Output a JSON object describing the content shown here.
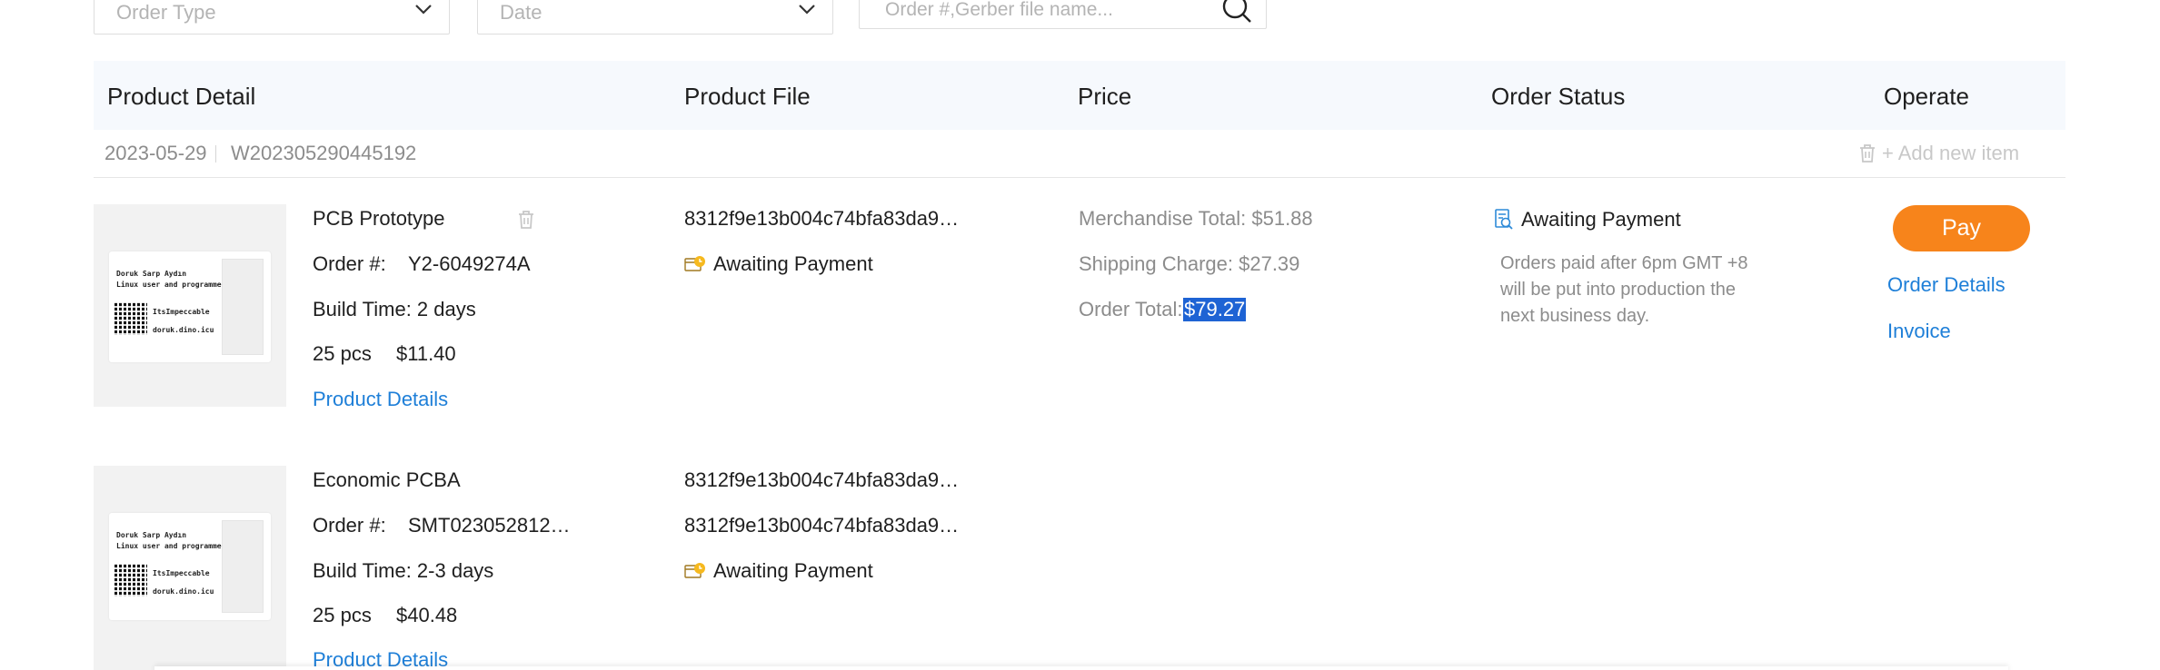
{
  "filters": {
    "order_type_placeholder": "Order Type",
    "date_placeholder": "Date",
    "search_placeholder": "Order #,Gerber file name..."
  },
  "table_headers": {
    "product_detail": "Product Detail",
    "product_file": "Product File",
    "price": "Price",
    "order_status": "Order Status",
    "operate": "Operate"
  },
  "group": {
    "date": "2023-05-29",
    "order_number": "W202305290445192",
    "add_item_label": "+ Add new item"
  },
  "rows": [
    {
      "name": "PCB Prototype",
      "order_label": "Order #:",
      "order_number": "Y2-6049274A",
      "build_time": "Build Time: 2 days",
      "qty": "25 pcs",
      "unit_price": "$11.40",
      "details_link": "Product Details",
      "file": "8312f9e13b004c74bfa83da9…",
      "file_status": "Awaiting Payment",
      "merchandise_total": "Merchandise Total: $51.88",
      "shipping_charge": "Shipping Charge: $27.39",
      "order_total_label": "Order Total:",
      "order_total_value": "$79.27",
      "order_status": "Awaiting Payment",
      "status_note": "Orders paid after 6pm GMT +8 will be put into production the next business day.",
      "pay_label": "Pay",
      "order_details_link": "Order Details",
      "invoice_link": "Invoice",
      "card": {
        "line1": "Doruk Sarp Aydın",
        "line2": "Linux user and programmer",
        "github": "ItsImpeccable",
        "site": "doruk.dino.icu"
      }
    },
    {
      "name": "Economic PCBA",
      "order_label": "Order #:",
      "order_number": "SMT023052812…",
      "build_time": "Build Time: 2-3 days",
      "qty": "25 pcs",
      "unit_price": "$40.48",
      "details_link": "Product Details",
      "file_1": "8312f9e13b004c74bfa83da9…",
      "file_2": "8312f9e13b004c74bfa83da9…",
      "file_status": "Awaiting Payment",
      "card": {
        "line1": "Doruk Sarp Aydın",
        "line2": "Linux user and programmer",
        "github": "ItsImpeccable",
        "site": "doruk.dino.icu"
      }
    }
  ],
  "colors": {
    "accent_orange": "#f7841b",
    "link_blue": "#1e7fd8",
    "header_bg": "#f6f9fd",
    "muted_text": "#8c8c8c"
  },
  "icons": [
    "chevron-down-icon",
    "search-icon",
    "trash-icon",
    "plus-icon",
    "payment-pending-icon",
    "order-status-icon"
  ]
}
